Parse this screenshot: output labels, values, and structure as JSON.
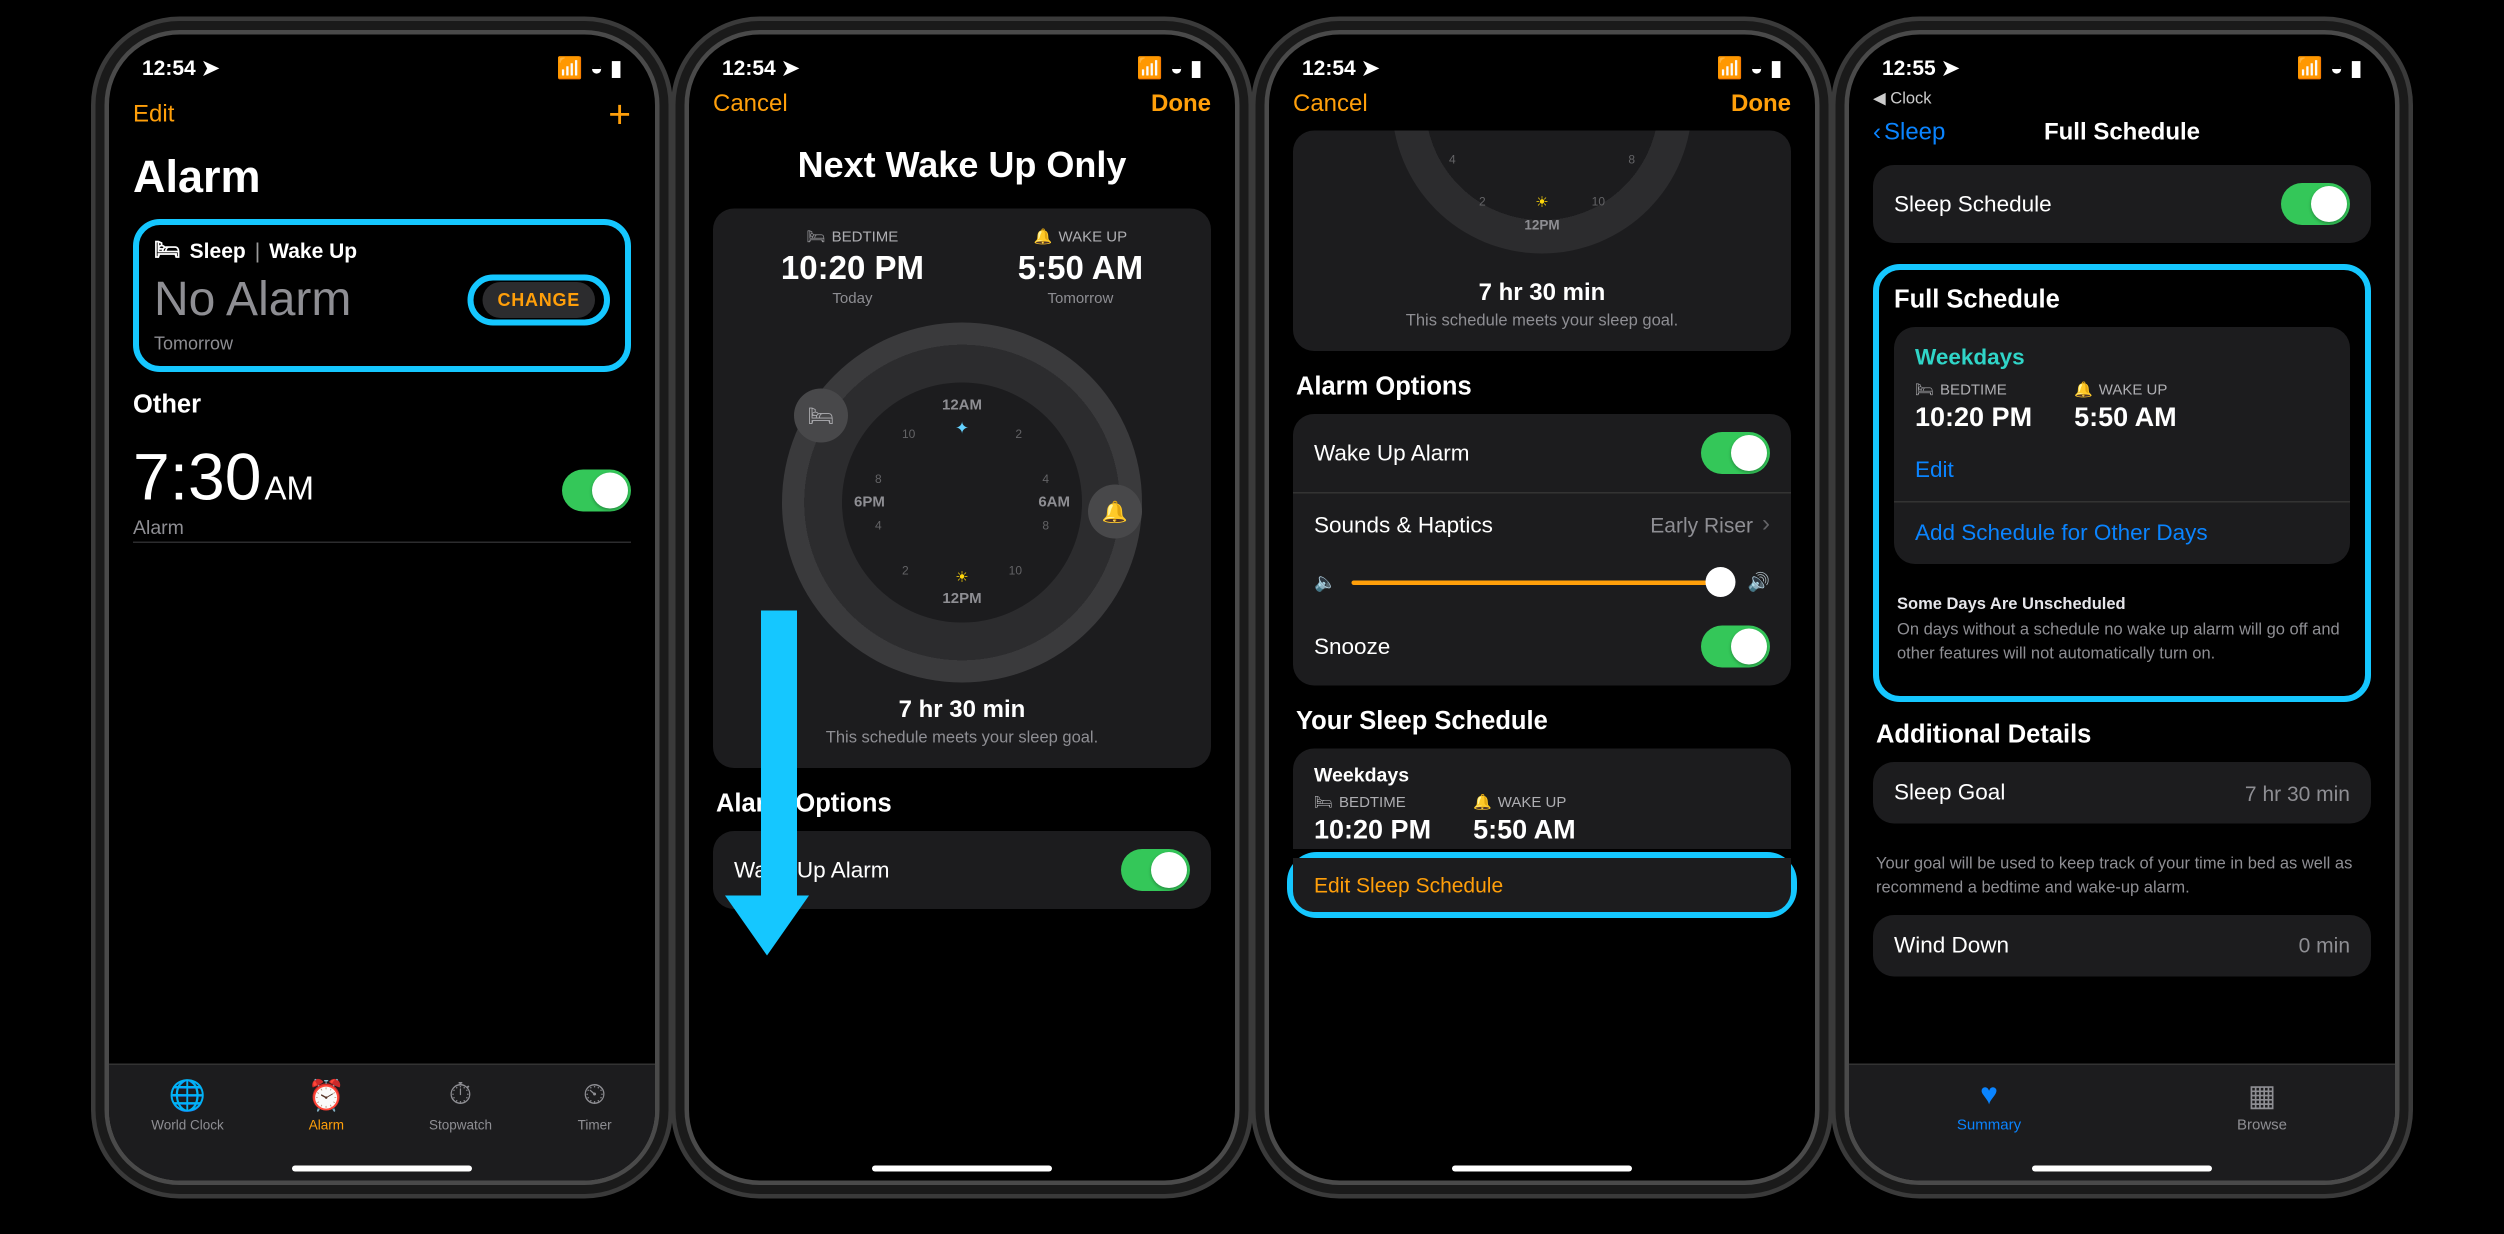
{
  "s1": {
    "time": "12:54",
    "editLabel": "Edit",
    "title": "Alarm",
    "sleepHeaderIcon": "🛏",
    "sleepHeaderA": "Sleep",
    "sleepHeaderB": "Wake Up",
    "noAlarm": "No Alarm",
    "changeLabel": "CHANGE",
    "tomorrow": "Tomorrow",
    "otherHeader": "Other",
    "alarmTime": "7:30",
    "alarmAmPm": "AM",
    "alarmSub": "Alarm",
    "tabs": {
      "worldClock": "World Clock",
      "alarm": "Alarm",
      "stopwatch": "Stopwatch",
      "timer": "Timer"
    }
  },
  "s2": {
    "time": "12:54",
    "cancel": "Cancel",
    "done": "Done",
    "title": "Next Wake Up Only",
    "bedLabel": "BEDTIME",
    "bedTime": "10:20 PM",
    "bedSub": "Today",
    "wakeLabel": "WAKE UP",
    "wakeTime": "5:50 AM",
    "wakeSub": "Tomorrow",
    "dial": {
      "t12am": "12AM",
      "t6am": "6AM",
      "t12pm": "12PM",
      "t6pm": "6PM"
    },
    "goal": "7 hr 30 min",
    "goalSub": "This schedule meets your sleep goal.",
    "alarmOptions": "Alarm Options",
    "wakeUpAlarm": "Wake Up Alarm"
  },
  "s3": {
    "time": "12:54",
    "cancel": "Cancel",
    "done": "Done",
    "dialPm": "12PM",
    "goal": "7 hr 30 min",
    "goalSub": "This schedule meets your sleep goal.",
    "alarmOptions": "Alarm Options",
    "wakeUpAlarm": "Wake Up Alarm",
    "soundsHaptics": "Sounds & Haptics",
    "soundsValue": "Early Riser",
    "snooze": "Snooze",
    "yourSleepSchedule": "Your Sleep Schedule",
    "scheduleName": "Weekdays",
    "bedLabel": "BEDTIME",
    "bedTime": "10:20 PM",
    "wakeLabel": "WAKE UP",
    "wakeTime": "5:50 AM",
    "editSleep": "Edit Sleep Schedule"
  },
  "s4": {
    "time": "12:55",
    "breadcrumb": "◀︎ Clock",
    "back": "Sleep",
    "navTitle": "Full Schedule",
    "sleepScheduleRow": "Sleep Schedule",
    "fullSchedule": "Full Schedule",
    "weekdays": "Weekdays",
    "bedLabel": "BEDTIME",
    "bedTime": "10:20 PM",
    "wakeLabel": "WAKE UP",
    "wakeTime": "5:50 AM",
    "edit": "Edit",
    "addSchedule": "Add Schedule for Other Days",
    "fnTitle": "Some Days Are Unscheduled",
    "fnBody": "On days without a schedule no wake up alarm will go off and other features will not automatically turn on.",
    "additionalDetails": "Additional Details",
    "sleepGoal": "Sleep Goal",
    "sleepGoalVal": "7 hr 30 min",
    "goalFootnote": "Your goal will be used to keep track of your time in bed as well as recommend a bedtime and wake-up alarm.",
    "windDown": "Wind Down",
    "windDownVal": "0 min",
    "tabs": {
      "summary": "Summary",
      "browse": "Browse"
    }
  }
}
